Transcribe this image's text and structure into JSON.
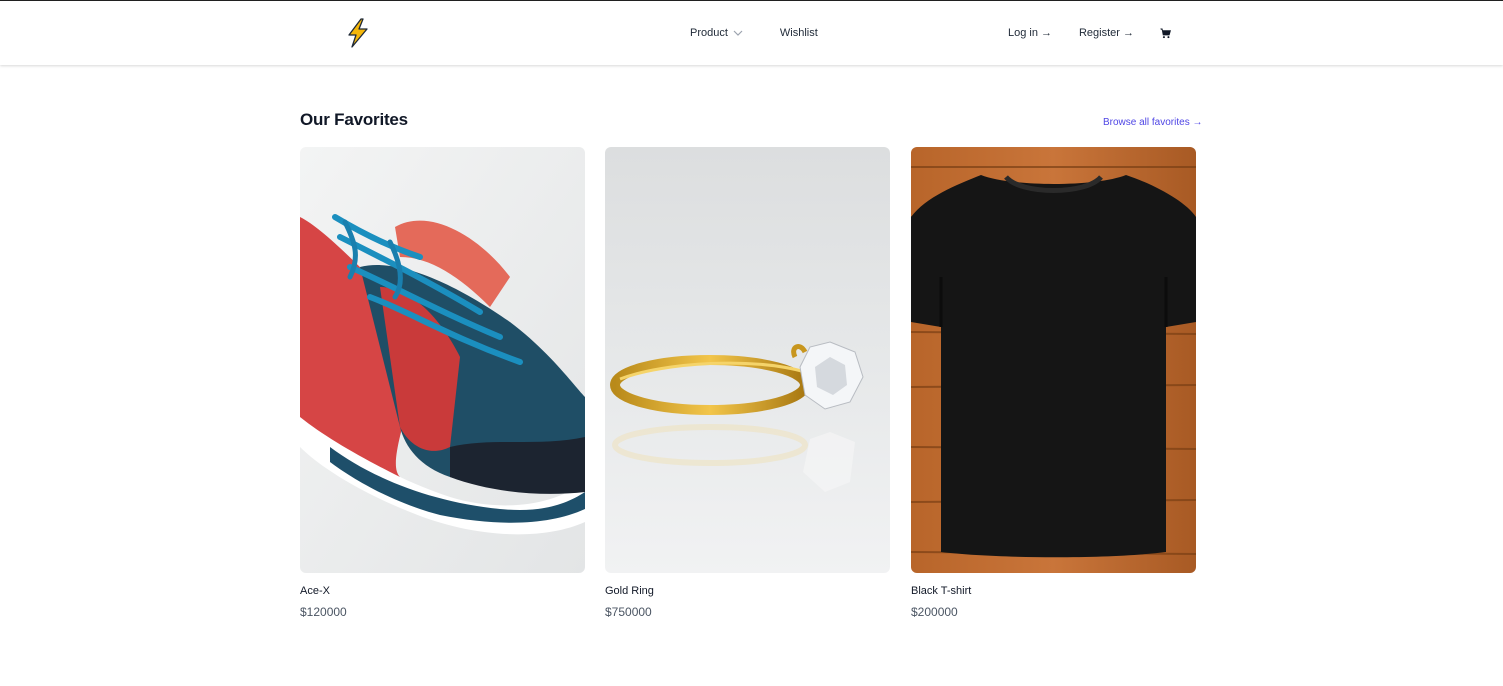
{
  "nav": {
    "logo_icon": "lightning-bolt-icon",
    "product_label": "Product",
    "wishlist_label": "Wishlist",
    "login_label": "Log in",
    "register_label": "Register",
    "arrow": "→",
    "cart_icon": "shopping-cart-icon"
  },
  "section": {
    "title": "Our Favorites",
    "browse_label": "Browse all favorites →"
  },
  "products": [
    {
      "name": "Ace-X",
      "price": "$120000",
      "image": "red-blue-sneaker"
    },
    {
      "name": "Gold Ring",
      "price": "$750000",
      "image": "gold-diamond-ring"
    },
    {
      "name": "Black T-shirt",
      "price": "$200000",
      "image": "black-tshirt-on-wood"
    }
  ],
  "colors": {
    "accent": "#4f46e5",
    "text": "#111827",
    "muted": "#4b5563"
  }
}
